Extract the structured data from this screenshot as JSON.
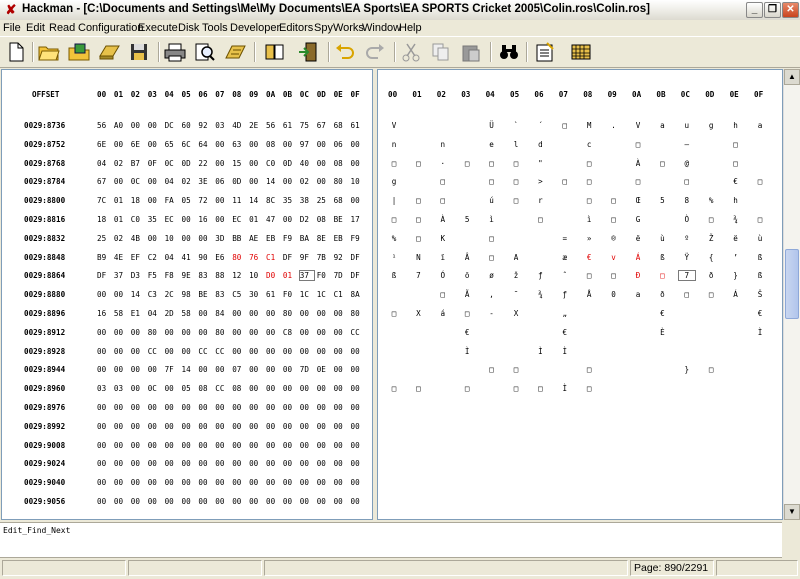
{
  "window": {
    "title": "Hackman - [C:\\Documents and Settings\\Me\\My Documents\\EA Sports\\EA SPORTS Cricket 2005\\Colin.ros\\Colin.ros]"
  },
  "menu": [
    "File",
    "Edit",
    "Read",
    "Configuration",
    "Execute",
    "Disk",
    "Tools",
    "Developer",
    "Editors",
    "SpyWorks",
    "Window",
    "Help"
  ],
  "toolbar": [
    "new-file-icon",
    "open-folder-icon",
    "save-disk-icon",
    "open-drive-icon",
    "save-floppy-icon",
    "print-icon",
    "find-icon",
    "calculator-icon",
    "book-icon",
    "exit-door-icon",
    "undo-icon",
    "redo-icon",
    "cut-icon",
    "copy-icon",
    "paste-icon",
    "binoculars-icon",
    "notepad-icon",
    "grid-icon"
  ],
  "hex": {
    "offset_header": "OFFSET",
    "columns": [
      "00",
      "01",
      "02",
      "03",
      "04",
      "05",
      "06",
      "07",
      "08",
      "09",
      "0A",
      "0B",
      "0C",
      "0D",
      "0E",
      "0F"
    ],
    "rows": [
      {
        "offset": "0029:8736",
        "bytes": [
          "56",
          "A0",
          "00",
          "00",
          "DC",
          "60",
          "92",
          "03",
          "4D",
          "2E",
          "56",
          "61",
          "75",
          "67",
          "68",
          "61"
        ]
      },
      {
        "offset": "0029:8752",
        "bytes": [
          "6E",
          "00",
          "6E",
          "00",
          "65",
          "6C",
          "64",
          "00",
          "63",
          "00",
          "08",
          "00",
          "97",
          "00",
          "06",
          "00"
        ]
      },
      {
        "offset": "0029:8768",
        "bytes": [
          "04",
          "02",
          "B7",
          "0F",
          "0C",
          "0D",
          "22",
          "00",
          "15",
          "00",
          "C0",
          "0D",
          "40",
          "00",
          "08",
          "00"
        ]
      },
      {
        "offset": "0029:8784",
        "bytes": [
          "67",
          "00",
          "0C",
          "00",
          "04",
          "02",
          "3E",
          "06",
          "0D",
          "00",
          "14",
          "00",
          "02",
          "00",
          "80",
          "10"
        ]
      },
      {
        "offset": "0029:8800",
        "bytes": [
          "7C",
          "01",
          "18",
          "00",
          "FA",
          "05",
          "72",
          "00",
          "11",
          "14",
          "8C",
          "35",
          "38",
          "25",
          "68",
          "00"
        ]
      },
      {
        "offset": "0029:8816",
        "bytes": [
          "18",
          "01",
          "C0",
          "35",
          "EC",
          "00",
          "16",
          "00",
          "EC",
          "01",
          "47",
          "00",
          "D2",
          "08",
          "BE",
          "17"
        ]
      },
      {
        "offset": "0029:8832",
        "bytes": [
          "25",
          "02",
          "4B",
          "00",
          "10",
          "00",
          "00",
          "3D",
          "BB",
          "AE",
          "EB",
          "F9",
          "BA",
          "8E",
          "EB",
          "F9"
        ]
      },
      {
        "offset": "0029:8848",
        "bytes": [
          "B9",
          "4E",
          "EF",
          "C2",
          "04",
          "41",
          "90",
          "E6",
          "80",
          "76",
          "C1",
          "DF",
          "9F",
          "7B",
          "92",
          "DF"
        ]
      },
      {
        "offset": "0029:8864",
        "bytes": [
          "DF",
          "37",
          "D3",
          "F5",
          "F8",
          "9E",
          "83",
          "88",
          "12",
          "10",
          "D0",
          "01",
          "37",
          "F0",
          "7D",
          "DF"
        ]
      },
      {
        "offset": "0029:8880",
        "bytes": [
          "00",
          "00",
          "14",
          "C3",
          "2C",
          "98",
          "BE",
          "83",
          "C5",
          "30",
          "61",
          "F0",
          "1C",
          "1C",
          "C1",
          "8A"
        ]
      },
      {
        "offset": "0029:8896",
        "bytes": [
          "16",
          "58",
          "E1",
          "04",
          "2D",
          "58",
          "00",
          "84",
          "00",
          "00",
          "00",
          "80",
          "00",
          "00",
          "00",
          "80"
        ]
      },
      {
        "offset": "0029:8912",
        "bytes": [
          "00",
          "00",
          "00",
          "80",
          "00",
          "00",
          "00",
          "80",
          "00",
          "00",
          "00",
          "C8",
          "00",
          "00",
          "00",
          "CC"
        ]
      },
      {
        "offset": "0029:8928",
        "bytes": [
          "00",
          "00",
          "00",
          "CC",
          "00",
          "00",
          "CC",
          "CC",
          "00",
          "00",
          "00",
          "00",
          "00",
          "00",
          "00",
          "00"
        ]
      },
      {
        "offset": "0029:8944",
        "bytes": [
          "00",
          "00",
          "00",
          "00",
          "7F",
          "14",
          "00",
          "00",
          "07",
          "00",
          "00",
          "00",
          "7D",
          "0E",
          "00",
          "00"
        ]
      },
      {
        "offset": "0029:8960",
        "bytes": [
          "03",
          "03",
          "00",
          "0C",
          "00",
          "05",
          "08",
          "CC",
          "08",
          "00",
          "00",
          "00",
          "00",
          "00",
          "00",
          "00"
        ]
      },
      {
        "offset": "0029:8976",
        "bytes": [
          "00",
          "00",
          "00",
          "00",
          "00",
          "00",
          "00",
          "00",
          "00",
          "00",
          "00",
          "00",
          "00",
          "00",
          "00",
          "00"
        ]
      },
      {
        "offset": "0029:8992",
        "bytes": [
          "00",
          "00",
          "00",
          "00",
          "00",
          "00",
          "00",
          "00",
          "00",
          "00",
          "00",
          "00",
          "00",
          "00",
          "00",
          "00"
        ]
      },
      {
        "offset": "0029:9008",
        "bytes": [
          "00",
          "00",
          "00",
          "00",
          "00",
          "00",
          "00",
          "00",
          "00",
          "00",
          "00",
          "00",
          "00",
          "00",
          "00",
          "00"
        ]
      },
      {
        "offset": "0029:9024",
        "bytes": [
          "00",
          "00",
          "00",
          "00",
          "00",
          "00",
          "00",
          "00",
          "00",
          "00",
          "00",
          "00",
          "00",
          "00",
          "00",
          "00"
        ]
      },
      {
        "offset": "0029:9040",
        "bytes": [
          "00",
          "00",
          "00",
          "00",
          "00",
          "00",
          "00",
          "00",
          "00",
          "00",
          "00",
          "00",
          "00",
          "00",
          "00",
          "00"
        ]
      },
      {
        "offset": "0029:9056",
        "bytes": [
          "00",
          "00",
          "00",
          "00",
          "00",
          "00",
          "00",
          "00",
          "00",
          "00",
          "00",
          "00",
          "00",
          "00",
          "00",
          "00"
        ]
      }
    ],
    "highlight_red": [
      [
        7,
        8
      ],
      [
        7,
        9
      ],
      [
        7,
        10
      ],
      [
        8,
        10
      ],
      [
        8,
        11
      ]
    ],
    "selected": [
      8,
      12
    ]
  },
  "ascii": {
    "columns": [
      "00",
      "01",
      "02",
      "03",
      "04",
      "05",
      "06",
      "07",
      "08",
      "09",
      "0A",
      "0B",
      "0C",
      "0D",
      "0E",
      "0F"
    ],
    "rows": [
      [
        "V",
        "",
        "",
        "",
        "Ü",
        "`",
        "´",
        "□",
        "M",
        ".",
        "V",
        "a",
        "u",
        "g",
        "h",
        "a"
      ],
      [
        "n",
        "",
        "n",
        "",
        "e",
        "l",
        "d",
        "",
        "c",
        "",
        "□",
        "",
        "—",
        "",
        "□",
        ""
      ],
      [
        "□",
        "□",
        "·",
        "□",
        "□",
        "□",
        "\"",
        "",
        "□",
        "",
        "À",
        "□",
        "@",
        "",
        "□",
        ""
      ],
      [
        "g",
        "",
        "□",
        "",
        "□",
        "□",
        ">",
        "□",
        "□",
        "",
        "□",
        "",
        "□",
        "",
        "€",
        "□"
      ],
      [
        "|",
        "□",
        "□",
        "",
        "ú",
        "□",
        "r",
        "",
        "□",
        "□",
        "Œ",
        "5",
        "8",
        "%",
        "h",
        ""
      ],
      [
        "□",
        "□",
        "À",
        "5",
        "ì",
        "",
        "□",
        "",
        "ì",
        "□",
        "G",
        "",
        "Ò",
        "□",
        "¾",
        "□"
      ],
      [
        "%",
        "□",
        "K",
        "",
        "□",
        "",
        "",
        "=",
        "»",
        "®",
        "ë",
        "ù",
        "º",
        "Ž",
        "ë",
        "ù"
      ],
      [
        "¹",
        "N",
        "ï",
        "Â",
        "□",
        "A",
        "",
        "æ",
        "€",
        "v",
        "Á",
        "ß",
        "Ÿ",
        "{",
        "’",
        "ß"
      ],
      [
        "ß",
        "7",
        "Ó",
        "õ",
        "ø",
        "ž",
        "ƒ",
        "ˆ",
        "□",
        "□",
        "Ð",
        "□",
        "7",
        "ð",
        "}",
        "ß"
      ],
      [
        "",
        "",
        "□",
        "Ã",
        ",",
        "˜",
        "¾",
        "ƒ",
        "Å",
        "0",
        "a",
        "ð",
        "□",
        "□",
        "Á",
        "Š"
      ],
      [
        "□",
        "X",
        "á",
        "□",
        "-",
        "X",
        "",
        "„",
        "",
        "",
        "",
        "€",
        "",
        "",
        "",
        "€"
      ],
      [
        "",
        "",
        "",
        "€",
        "",
        "",
        "",
        "€",
        "",
        "",
        "",
        "È",
        "",
        "",
        "",
        "Ì"
      ],
      [
        "",
        "",
        "",
        "Ì",
        "",
        "",
        "Ì",
        "Ì",
        "",
        "",
        "",
        "",
        "",
        "",
        "",
        ""
      ],
      [
        "",
        "",
        "",
        "",
        "□",
        "□",
        "",
        "",
        "□",
        "",
        "",
        "",
        "}",
        "□",
        "",
        ""
      ],
      [
        "□",
        "□",
        "",
        "□",
        "",
        "□",
        "□",
        "Ì",
        "□",
        "",
        "",
        "",
        "",
        "",
        "",
        ""
      ]
    ],
    "highlight_red": [
      [
        7,
        8
      ],
      [
        7,
        9
      ],
      [
        7,
        10
      ],
      [
        8,
        10
      ],
      [
        8,
        11
      ]
    ],
    "selected": [
      8,
      12
    ]
  },
  "command": {
    "text": "Edit_Find_Next"
  },
  "status": {
    "page": "Page: 890/2291"
  }
}
